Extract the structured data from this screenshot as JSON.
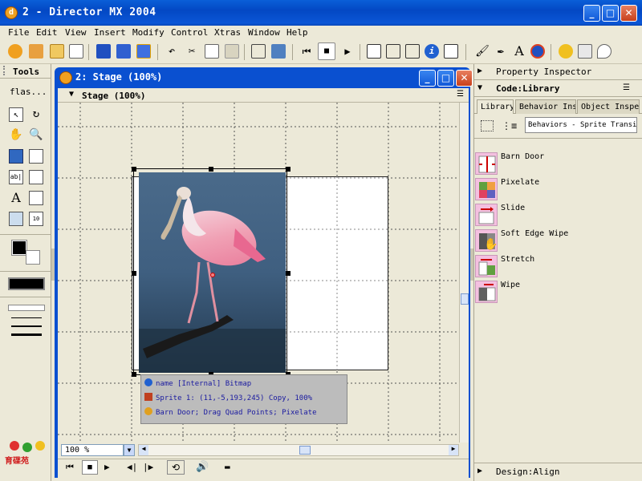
{
  "app": {
    "title": "2 - Director MX 2004"
  },
  "menu": [
    "File",
    "Edit",
    "View",
    "Insert",
    "Modify",
    "Control",
    "Xtras",
    "Window",
    "Help"
  ],
  "tools": {
    "header": "Tools",
    "dropdown": "flas..."
  },
  "stage_window": {
    "title": "2: Stage (100%)",
    "subheader": "Stage (100%)",
    "zoom_value": "100 %"
  },
  "sprite_info": {
    "line1": "name [Internal] Bitmap",
    "line2": "Sprite 1: (11,-5,193,245) Copy, 100%",
    "line3": "Barn Door; Drag Quad Points; Pixelate"
  },
  "right_panel": {
    "property_inspector": "Property Inspector",
    "code_library": "Code:Library",
    "tabs": [
      "Library",
      "Behavior Inspe",
      "Object Inspect"
    ],
    "category_select": "Behaviors - Sprite Transit",
    "behaviors": [
      "Barn Door",
      "Pixelate",
      "Slide",
      "Soft Edge Wipe",
      "Stretch",
      "Wipe"
    ],
    "design_align": "Design:Align"
  },
  "logo_text": "育碟苑",
  "colors": {
    "titlebar": "#0a5fd8",
    "chrome": "#ece9d8",
    "accent_pink": "#f4c0e0"
  }
}
